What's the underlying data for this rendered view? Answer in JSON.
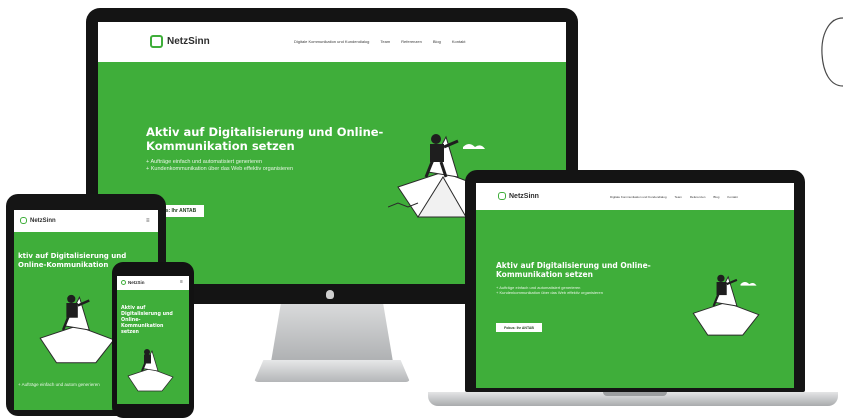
{
  "brand": {
    "name": "NetzSinn",
    "mobile_name": "NetzSin"
  },
  "nav": {
    "items": [
      "Digitale Kommunikation und Kundendialog",
      "Team",
      "Referenzen",
      "Blog",
      "Kontakt"
    ]
  },
  "hero": {
    "title": "Aktiv auf Digitalisierung und Online-Kommunikation setzen",
    "title_line1": "Aktiv auf Digitalisierung und Online-",
    "title_line2": "Kommunikation setzen",
    "tablet_line1": "ktiv auf Digitalisierung und",
    "tablet_line2": "Online-Kommunikation",
    "phone_lines": [
      "Aktiv auf",
      "Digitalisierung und",
      "Online-",
      "Kommunikation",
      "setzen"
    ],
    "bullets": [
      "Aufträge einfach und automatisiert generieren",
      "Kundenkommunikation über das Web effektiv organisieren"
    ],
    "tablet_bullet": "Aufträge einfach und autom generieren",
    "cta": "Fokus: Ihr ANTAB",
    "cta_small": "Fokus: Ihr ANTAB"
  },
  "colors": {
    "accent": "#3fae3a",
    "frame": "#1a1a1a",
    "silver": "#c9cbcd"
  }
}
